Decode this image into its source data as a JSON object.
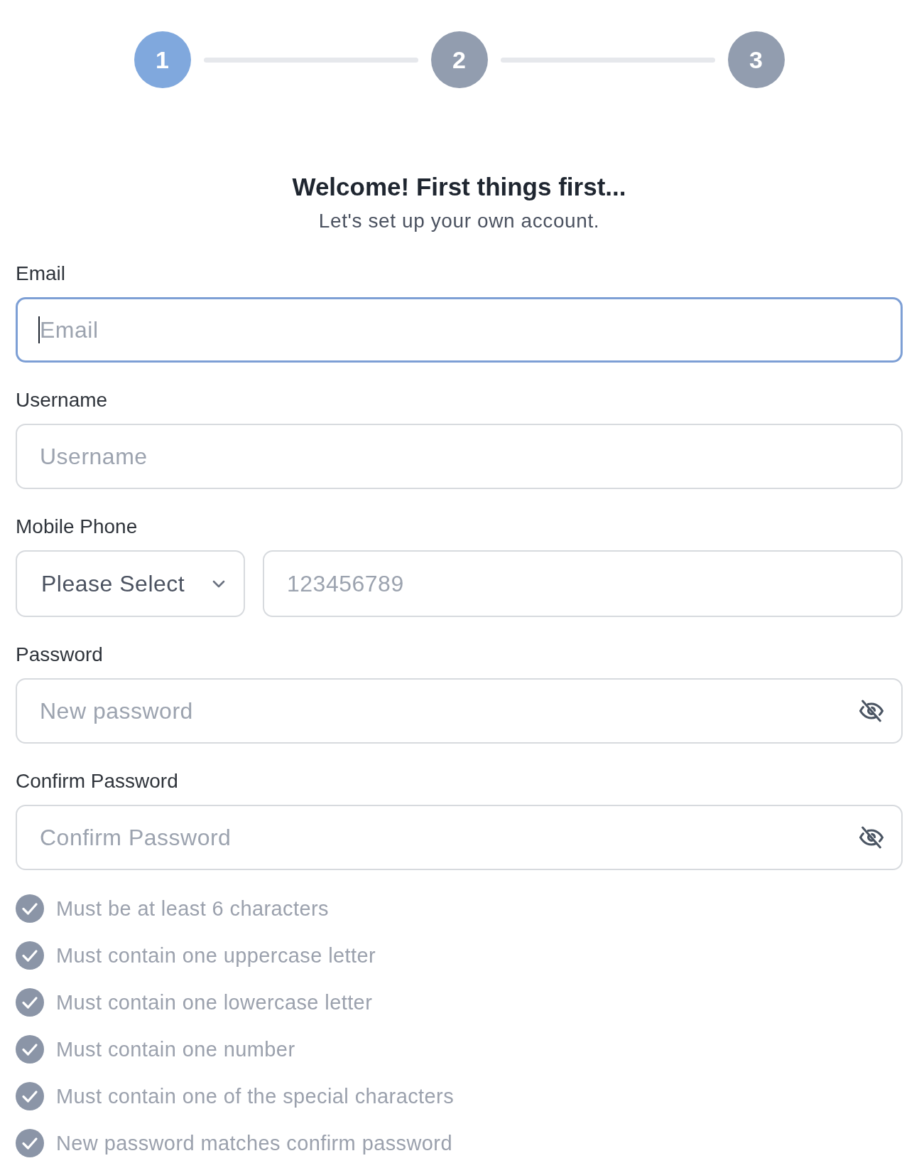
{
  "stepper": {
    "steps": [
      {
        "label": "1",
        "selected": true
      },
      {
        "label": "2",
        "selected": false
      },
      {
        "label": "3",
        "selected": false
      }
    ]
  },
  "heading": {
    "title": "Welcome! First things first...",
    "subtitle": "Let's set up your own account."
  },
  "form": {
    "fields": [
      {
        "kind": "text",
        "label": "Email",
        "placeholder": "Email",
        "focused": true
      },
      {
        "kind": "text",
        "label": "Username",
        "placeholder": "Username",
        "focused": false
      },
      {
        "kind": "phone",
        "label": "Mobile Phone",
        "country_select": {
          "value": "Please Select"
        },
        "placeholder": "123456789",
        "focused": false
      },
      {
        "kind": "password",
        "label": "Password",
        "placeholder": "New password",
        "focused": false,
        "password_visible": false
      },
      {
        "kind": "password",
        "label": "Confirm Password",
        "placeholder": "Confirm Password",
        "focused": false,
        "password_visible": false
      }
    ]
  },
  "requirements": [
    {
      "text": "Must be at least 6 characters",
      "met": false
    },
    {
      "text": "Must contain one uppercase letter",
      "met": false
    },
    {
      "text": "Must contain one lowercase letter",
      "met": false
    },
    {
      "text": "Must contain one number",
      "met": false
    },
    {
      "text": "Must contain one of the special characters",
      "met": false
    },
    {
      "text": "New password matches confirm password",
      "met": false
    }
  ]
}
